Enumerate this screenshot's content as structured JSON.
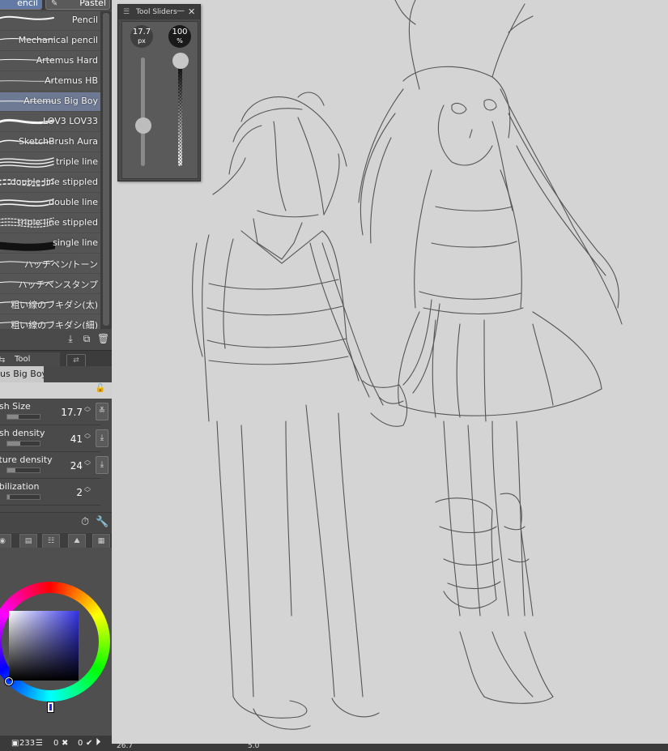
{
  "brush_tabs": {
    "active": "encil",
    "inactive": "Pastel"
  },
  "brushes": [
    {
      "name": "Pencil",
      "selected": false
    },
    {
      "name": "Mechanical pencil",
      "selected": false
    },
    {
      "name": "Artemus Hard",
      "selected": false
    },
    {
      "name": "Artemus HB",
      "selected": false
    },
    {
      "name": "Artemus Big Boy",
      "selected": true
    },
    {
      "name": "LOV3 LOV33",
      "selected": false
    },
    {
      "name": "SketchBrush Aura",
      "selected": false
    },
    {
      "name": "triple line",
      "selected": false
    },
    {
      "name": "double line stippled",
      "selected": false
    },
    {
      "name": "double line",
      "selected": false
    },
    {
      "name": "triple line stippled",
      "selected": false
    },
    {
      "name": "single line",
      "selected": false
    },
    {
      "name": "ハッチペン/トーン",
      "selected": false
    },
    {
      "name": "ハッチペンスタンプ",
      "selected": false
    },
    {
      "name": "粗い線のフキダシ(太)",
      "selected": false
    },
    {
      "name": "粗い線のフキダシ(細)",
      "selected": false
    }
  ],
  "tool_settings": {
    "tab_label": "Tool Settings",
    "tool_name": "us Big Boy",
    "params": [
      {
        "label": "ush Size",
        "value": "17.7",
        "level": 0.35
      },
      {
        "label": "ush density",
        "value": "41",
        "level": 0.41
      },
      {
        "label": "xture density",
        "value": "24",
        "level": 0.24
      },
      {
        "label": "abilization",
        "value": "2",
        "level": 0.08
      }
    ]
  },
  "color": {
    "selected_hex": "#3434e6"
  },
  "status": {
    "count": "233",
    "left_a": "0",
    "left_b": "0"
  },
  "canvas_status": {
    "zoom": "26.7",
    "angle": "5.0"
  },
  "tool_sliders": {
    "title": "Tool Sliders",
    "size_value": "17.7",
    "size_unit": "px",
    "opacity_value": "100",
    "opacity_unit": "%",
    "size_level": 0.35,
    "opacity_level": 1.0
  }
}
